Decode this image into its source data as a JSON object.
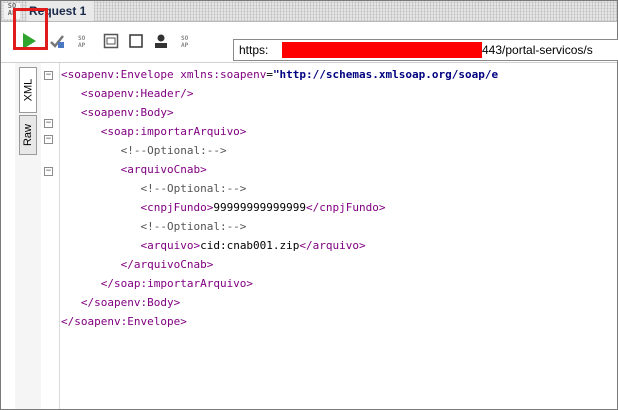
{
  "window": {
    "logo_line1": "SO",
    "logo_line2": "AP",
    "title": "Request 1"
  },
  "toolbar": {
    "icons": [
      "play-icon",
      "validate-icon",
      "soap-icon",
      "window-icon",
      "square-icon",
      "user-icon",
      "soap-icon-2"
    ],
    "url_scheme": "https:",
    "url_rest": "443/portal-servicos/s"
  },
  "tabs": {
    "xml_label": "XML",
    "raw_label": "Raw"
  },
  "code": {
    "lines": [
      {
        "segments": [
          [
            "tag",
            "<soapenv:Envelope "
          ],
          [
            "attr",
            "xmlns:soapenv"
          ],
          [
            "txt",
            "="
          ],
          [
            "aval",
            "\"http://schemas.xmlsoap.org/soap/e"
          ]
        ]
      },
      {
        "segments": [
          [
            "tag",
            "   <soapenv:Header/>"
          ]
        ]
      },
      {
        "segments": [
          [
            "tag",
            "   <soapenv:Body>"
          ]
        ]
      },
      {
        "segments": [
          [
            "tag",
            "      <soap:importarArquivo>"
          ]
        ]
      },
      {
        "segments": [
          [
            "cmt",
            "         <!--Optional:-->"
          ]
        ]
      },
      {
        "segments": [
          [
            "tag",
            "         <arquivoCnab>"
          ]
        ]
      },
      {
        "segments": [
          [
            "cmt",
            "            <!--Optional:-->"
          ]
        ]
      },
      {
        "segments": [
          [
            "tag",
            "            <cnpjFundo>"
          ],
          [
            "txt",
            "99999999999999"
          ],
          [
            "tag",
            "</cnpjFundo>"
          ]
        ]
      },
      {
        "segments": [
          [
            "cmt",
            "            <!--Optional:-->"
          ]
        ]
      },
      {
        "segments": [
          [
            "tag",
            "            <arquivo>"
          ],
          [
            "txt",
            "cid:cnab001.zip"
          ],
          [
            "tag",
            "</arquivo>"
          ]
        ]
      },
      {
        "segments": [
          [
            "tag",
            "         </arquivoCnab>"
          ]
        ]
      },
      {
        "segments": [
          [
            "tag",
            "      </soap:importarArquivo>"
          ]
        ]
      },
      {
        "segments": [
          [
            "tag",
            "   </soapenv:Body>"
          ]
        ]
      },
      {
        "segments": [
          [
            "tag",
            "</soapenv:Envelope>"
          ]
        ]
      }
    ]
  }
}
